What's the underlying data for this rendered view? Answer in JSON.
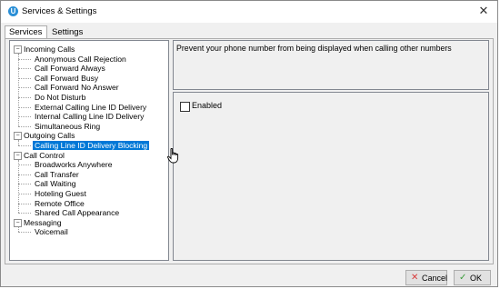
{
  "window": {
    "title": "Services & Settings",
    "close_symbol": "✕",
    "app_icon_glyph": "U"
  },
  "tabs": [
    {
      "label": "Services",
      "active": true
    },
    {
      "label": "Settings",
      "active": false
    }
  ],
  "tree": {
    "groups": [
      {
        "label": "Incoming Calls",
        "children": [
          "Anonymous Call Rejection",
          "Call Forward Always",
          "Call Forward Busy",
          "Call Forward No Answer",
          "Do Not Disturb",
          "External Calling Line ID Delivery",
          "Internal Calling Line ID Delivery",
          "Simultaneous Ring"
        ]
      },
      {
        "label": "Outgoing Calls",
        "children": [
          "Calling Line ID Delivery Blocking"
        ]
      },
      {
        "label": "Call Control",
        "children": [
          "Broadworks Anywhere",
          "Call Transfer",
          "Call Waiting",
          "Hoteling Guest",
          "Remote Office",
          "Shared Call Appearance"
        ]
      },
      {
        "label": "Messaging",
        "children": [
          "Voicemail"
        ]
      }
    ],
    "expander_symbol": "−",
    "selected": "Calling Line ID Delivery Blocking"
  },
  "description": "Prevent your phone number from being displayed when calling other numbers",
  "settings": {
    "enabled_label": "Enabled",
    "enabled_checked": false
  },
  "buttons": {
    "cancel_label": "Cancel",
    "cancel_icon": "✕",
    "ok_label": "OK",
    "ok_icon": "✓"
  },
  "colors": {
    "selection": "#0078d7",
    "cancel_icon": "#d83b3b",
    "ok_icon": "#3c9d3c",
    "app_icon": "#2a8fd6"
  }
}
